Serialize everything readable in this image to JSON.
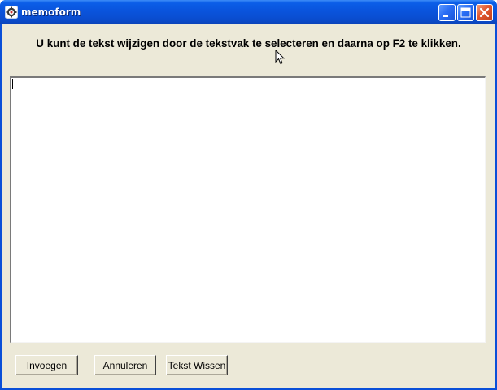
{
  "window": {
    "title": "memoform"
  },
  "instruction": "U kunt de tekst wijzigen door de tekstvak te selecteren en daarna op F2 te klikken.",
  "memo": {
    "value": ""
  },
  "buttons": {
    "insert_label": "Invoegen",
    "cancel_label": "Annuleren",
    "clear_label": "Tekst Wissen"
  },
  "icons": {
    "app": "app-gear-icon",
    "minimize": "minimize-icon",
    "maximize": "maximize-icon",
    "close": "close-icon",
    "cursor": "mouse-pointer-icon"
  },
  "colors": {
    "titlebar": "#0a55de",
    "client_bg": "#ece9d8",
    "close_button": "#e2582f"
  }
}
